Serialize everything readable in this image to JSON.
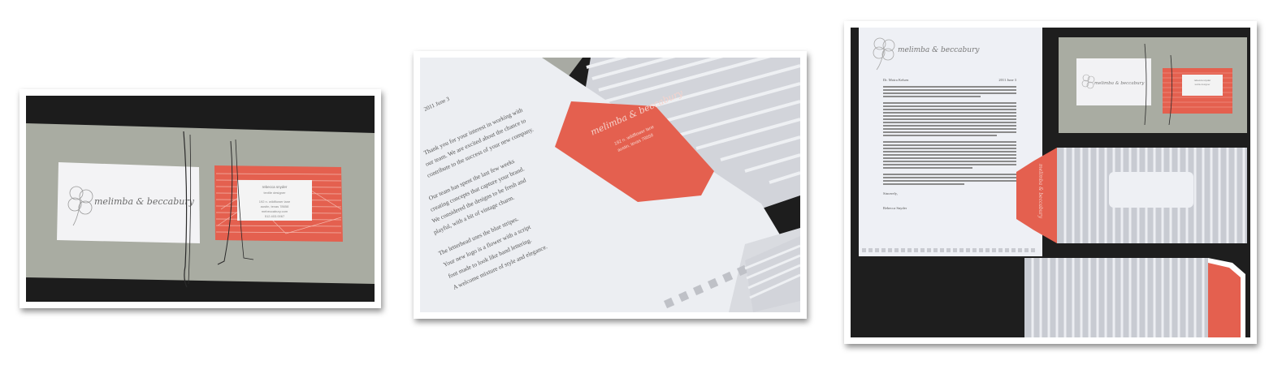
{
  "photos": [
    {
      "id": "photo-1",
      "brand": "melimba & beccabury",
      "card_name": "rebecca snyder",
      "card_title": "textile designer",
      "address_line": "192 n. wildflower lane",
      "city_line": "austin, texas 78658",
      "email": "mebeccabury.com",
      "phone": "512.403.0067"
    },
    {
      "id": "photo-2",
      "brand": "melimba & beccabury",
      "address_line": "192 n. wildflower lane",
      "city_line": "austin, texas 78658",
      "letter_date": "2011 June 3",
      "letter_lines": [
        "Thank you for your interest in working with",
        "our team. We are excited about the chance to",
        "contribute to the success of your new company.",
        "Our team has spent the last few weeks",
        "creating concepts that capture your brand.",
        "We considered the designs to be fresh and",
        "playful, with a bit of vintage charm.",
        "The letterhead uses the blue stripes.",
        "Your new logo is a flower with a script",
        "font made to look like hand lettering.",
        "A welcome mixture of style and elegance."
      ]
    },
    {
      "id": "photo-3",
      "brand": "melimba & beccabury",
      "salutation": "Dr. Moira Kelsen",
      "letter_date": "2011 June 3",
      "closing": "Sincerely,",
      "signature": "Rebecca Snyder",
      "business_card_name": "rebecca snyder",
      "business_card_title": "textile designer"
    }
  ],
  "colors": {
    "coral": "#e4604f",
    "gray_board": "#a9aca2",
    "paper": "#eef0f4",
    "stripe": "#c6c9d0",
    "background": "#1f1f1f"
  }
}
